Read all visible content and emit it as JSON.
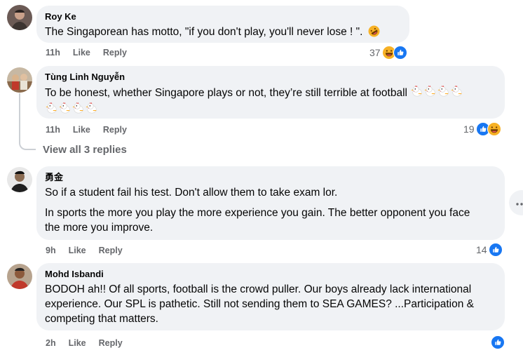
{
  "comments": [
    {
      "author": "Roy Ke",
      "paragraphs": [
        "The Singaporean has motto, \"if you don't play, you'll never lose ! \"."
      ],
      "time": "11h",
      "like_label": "Like",
      "reply_label": "Reply",
      "reaction_count": "37",
      "reactions": [
        "haha",
        "like"
      ]
    },
    {
      "author": "Tùng Linh Nguyễn",
      "paragraphs": [
        "To be honest, whether Singapore plays or not, they’re still terrible at football"
      ],
      "time": "11h",
      "like_label": "Like",
      "reply_label": "Reply",
      "reaction_count": "19",
      "reactions": [
        "like",
        "haha"
      ],
      "view_replies": "View all 3 replies"
    },
    {
      "author": "勇金",
      "paragraphs": [
        "So if a student fail his test. Don't allow them to take exam lor.",
        "In sports the more you play the more experience you gain. The better opponent you face the more you improve."
      ],
      "time": "9h",
      "like_label": "Like",
      "reply_label": "Reply",
      "reaction_count": "14",
      "reactions": [
        "like"
      ]
    },
    {
      "author": "Mohd Isbandi",
      "paragraphs": [
        "BODOH ah!! Of all sports, football is the crowd puller. Our boys already lack international experience. Our SPL is pathetic. Still not sending them to SEA GAMES? ...Participation & competing that matters."
      ],
      "time": "2h",
      "like_label": "Like",
      "reply_label": "Reply",
      "reaction_count": "",
      "reactions": [
        "like"
      ]
    }
  ],
  "colors": {
    "bubble": "#f0f2f5",
    "meta": "#65676b",
    "like": "#1877f2",
    "haha": "#f7b125"
  },
  "icons": [
    "rofl-emoji-icon",
    "chicken-emoji-icon",
    "like-reaction-icon",
    "haha-reaction-icon",
    "more-options-icon"
  ]
}
